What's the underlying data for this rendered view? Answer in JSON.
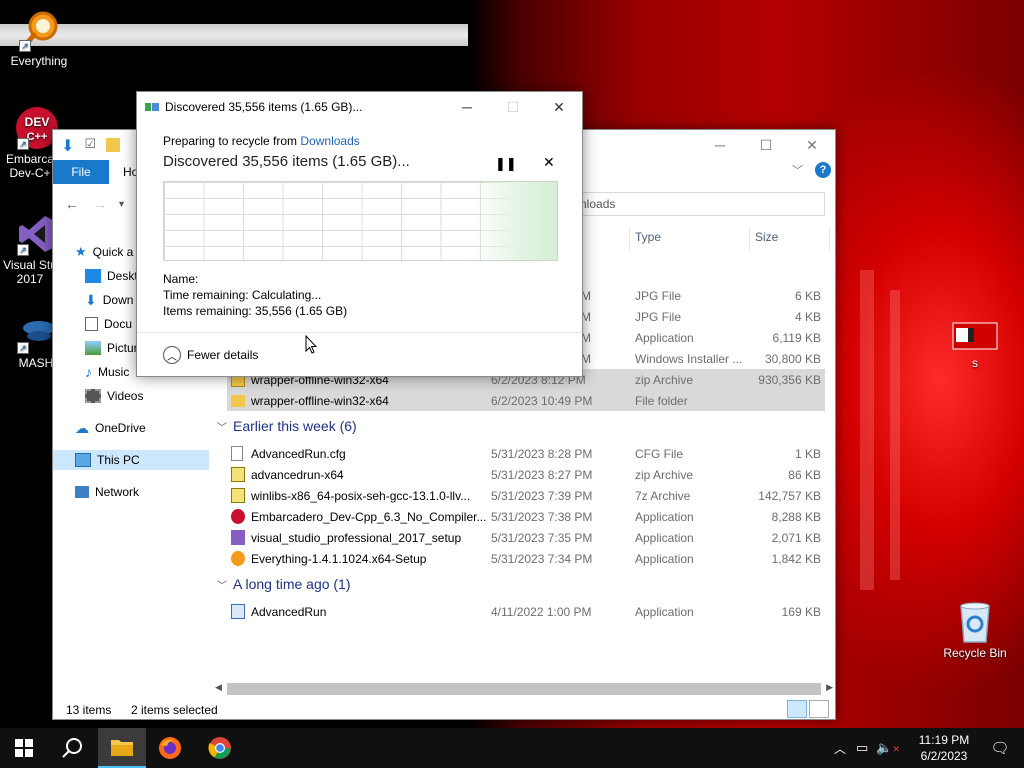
{
  "desktop": {
    "icons": [
      {
        "label": "Everything"
      },
      {
        "label": "Embarca Dev-C+"
      },
      {
        "label": "Visual Stu 2017"
      },
      {
        "label": "MASH"
      },
      {
        "label": "s"
      },
      {
        "label": "Recycle Bin"
      }
    ]
  },
  "explorer": {
    "tabs": {
      "file": "File",
      "home": "Ho"
    },
    "address_partial": "nloads",
    "sidebar": [
      {
        "label": "Quick a"
      },
      {
        "label": "Deskt"
      },
      {
        "label": "Down"
      },
      {
        "label": "Docu"
      },
      {
        "label": "Pictur"
      },
      {
        "label": "Music"
      },
      {
        "label": "Videos"
      },
      {
        "label": "OneDrive"
      },
      {
        "label": "This PC"
      },
      {
        "label": "Network"
      }
    ],
    "columns": {
      "type": "Type",
      "size": "Size"
    },
    "partial_rows": [
      {
        "date_frag": "M",
        "type": "JPG File",
        "size": "6 KB"
      },
      {
        "date_frag": "M",
        "type": "JPG File",
        "size": "4 KB"
      },
      {
        "date_frag": "M",
        "type": "Application",
        "size": "6,119 KB"
      },
      {
        "date_frag": "M",
        "type": "Windows Installer ...",
        "size": "30,800 KB"
      }
    ],
    "today_rows": [
      {
        "name": "wrapper-offline-win32-x64",
        "date": "6/2/2023 8:12 PM",
        "type": "zip Archive",
        "size": "930,356 KB"
      },
      {
        "name": "wrapper-offline-win32-x64",
        "date": "6/2/2023 10:49 PM",
        "type": "File folder",
        "size": ""
      }
    ],
    "groups": [
      {
        "label": "Earlier this week (6)"
      },
      {
        "label": "A long time ago (1)"
      }
    ],
    "week_rows": [
      {
        "name": "AdvancedRun.cfg",
        "date": "5/31/2023 8:28 PM",
        "type": "CFG File",
        "size": "1 KB"
      },
      {
        "name": "advancedrun-x64",
        "date": "5/31/2023 8:27 PM",
        "type": "zip Archive",
        "size": "86 KB"
      },
      {
        "name": "winlibs-x86_64-posix-seh-gcc-13.1.0-llv...",
        "date": "5/31/2023 7:39 PM",
        "type": "7z Archive",
        "size": "142,757 KB"
      },
      {
        "name": "Embarcadero_Dev-Cpp_6.3_No_Compiler...",
        "date": "5/31/2023 7:38 PM",
        "type": "Application",
        "size": "8,288 KB"
      },
      {
        "name": "visual_studio_professional_2017_setup",
        "date": "5/31/2023 7:35 PM",
        "type": "Application",
        "size": "2,071 KB"
      },
      {
        "name": "Everything-1.4.1.1024.x64-Setup",
        "date": "5/31/2023 7:34 PM",
        "type": "Application",
        "size": "1,842 KB"
      }
    ],
    "old_rows": [
      {
        "name": "AdvancedRun",
        "date": "4/11/2022 1:00 PM",
        "type": "Application",
        "size": "169 KB"
      }
    ],
    "status": {
      "items": "13 items",
      "selected": "2 items selected"
    }
  },
  "dialog": {
    "title": "Discovered 35,556 items (1.65 GB)...",
    "preparing_prefix": "Preparing to recycle from ",
    "preparing_link": "Downloads",
    "heading": "Discovered 35,556 items (1.65 GB)...",
    "name_label": "Name:",
    "time_remaining": "Time remaining:  Calculating...",
    "items_remaining": "Items remaining:  35,556 (1.65 GB)",
    "fewer_details": "Fewer details"
  },
  "taskbar": {
    "time": "11:19 PM",
    "date": "6/2/2023"
  }
}
